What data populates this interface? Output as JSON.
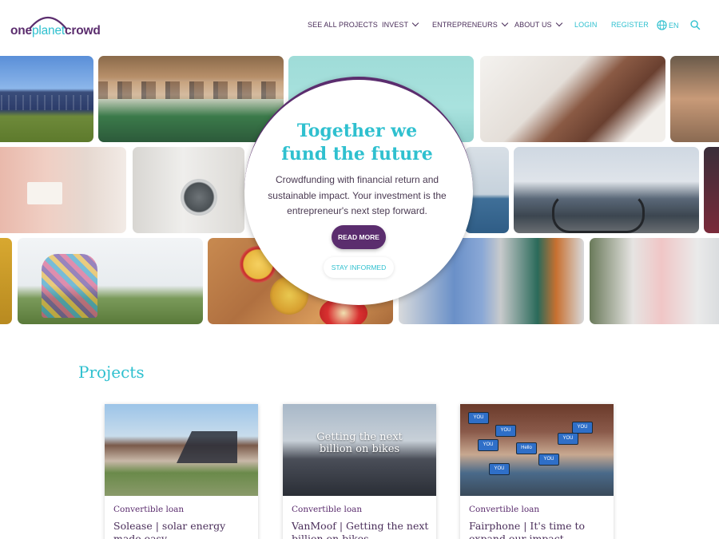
{
  "brand": {
    "logo_one": "one",
    "logo_planet": "planet",
    "logo_crowd": "crowd",
    "colors": {
      "primary": "#5b2d6e",
      "accent": "#2fc0cf"
    }
  },
  "nav": {
    "see_all_projects": "SEE ALL PROJECTS",
    "invest": "INVEST",
    "entrepreneurs": "ENTREPRENEURS",
    "about_us": "ABOUT US",
    "login": "LOGIN",
    "register": "REGISTER",
    "language": "EN",
    "icons": [
      "chevron-down-icon",
      "globe-icon",
      "search-icon"
    ]
  },
  "hero": {
    "title_line1": "Together we",
    "title_line2": "fund the future",
    "text": "Crowdfunding with financial return and sustainable impact. Your investment is the entrepreneur's next step forward.",
    "read_more": "READ MORE",
    "stay_informed": "STAY INFORMED"
  },
  "projects": {
    "heading": "Projects",
    "cards": [
      {
        "type": "Convertible loan",
        "title": "Solease | solar energy made easy"
      },
      {
        "type": "Convertible loan",
        "title": "VanMoof | Getting the next billion on bikes",
        "image_text": "Getting the next billion on bikes"
      },
      {
        "type": "Convertible loan",
        "title": "Fairphone | It's time to expand our impact",
        "image_bubbles": [
          "YOU",
          "YOU",
          "YOU",
          "Hello",
          "YOU",
          "YOU",
          "YOU",
          "YOU"
        ]
      }
    ]
  }
}
